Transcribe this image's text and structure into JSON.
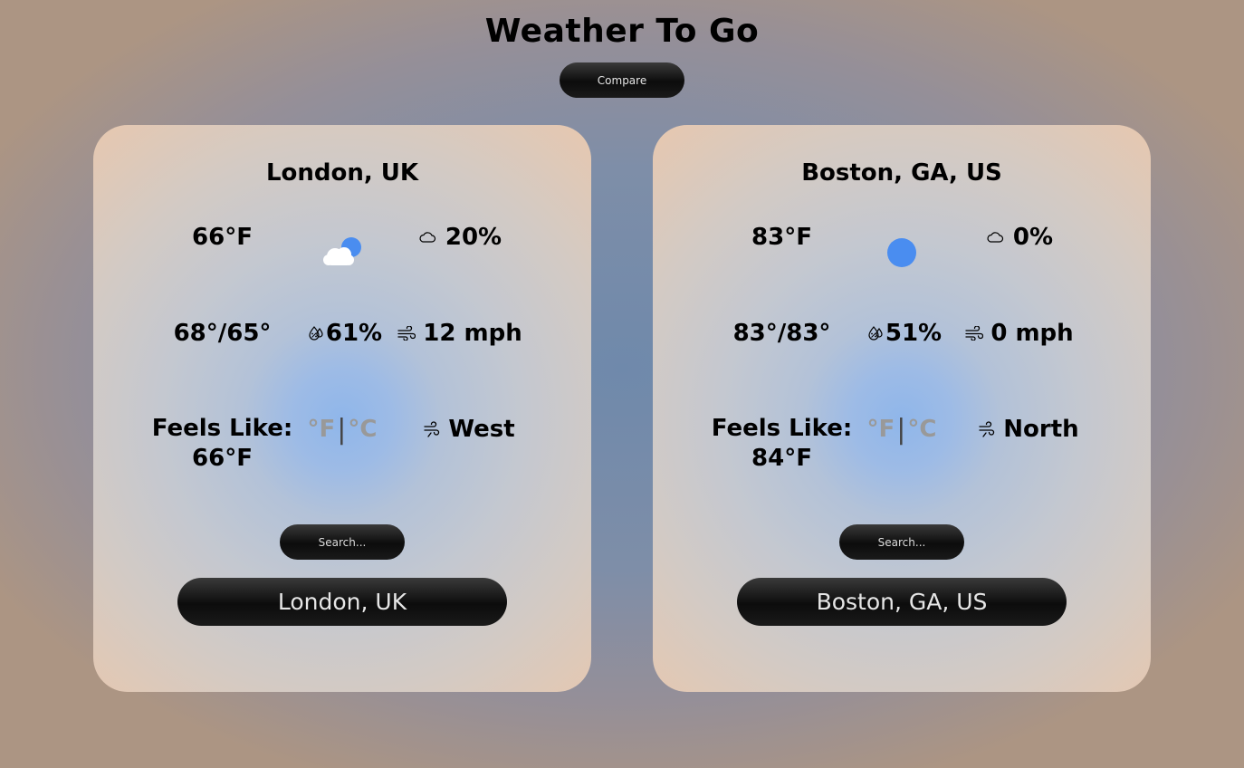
{
  "header": {
    "title": "Weather To Go",
    "compare_label": "Compare"
  },
  "cards": [
    {
      "location": "London, UK",
      "temperature": "66°F",
      "weather_icon": "partly-cloudy-icon",
      "cloudiness": "20%",
      "high_low": "68°/65°",
      "humidity": "61%",
      "wind_speed": "12 mph",
      "feels_like_label": "Feels Like:",
      "feels_like": "66°F",
      "unit_f": "°F",
      "unit_sep": "|",
      "unit_c": "°C",
      "wind_direction": "West",
      "search_placeholder": "Search...",
      "city_button": "London, UK"
    },
    {
      "location": "Boston, GA, US",
      "temperature": "83°F",
      "weather_icon": "clear-sky-icon",
      "cloudiness": "0%",
      "high_low": "83°/83°",
      "humidity": "51%",
      "wind_speed": "0 mph",
      "feels_like_label": "Feels Like:",
      "feels_like": "84°F",
      "unit_f": "°F",
      "unit_sep": "|",
      "unit_c": "°C",
      "wind_direction": "North",
      "search_placeholder": "Search...",
      "city_button": "Boston, GA, US"
    }
  ],
  "colors": {
    "sun": "#4a8df0",
    "button_bg": "#111111",
    "button_text": "#e6e6e6",
    "unit_text": "#999999"
  }
}
